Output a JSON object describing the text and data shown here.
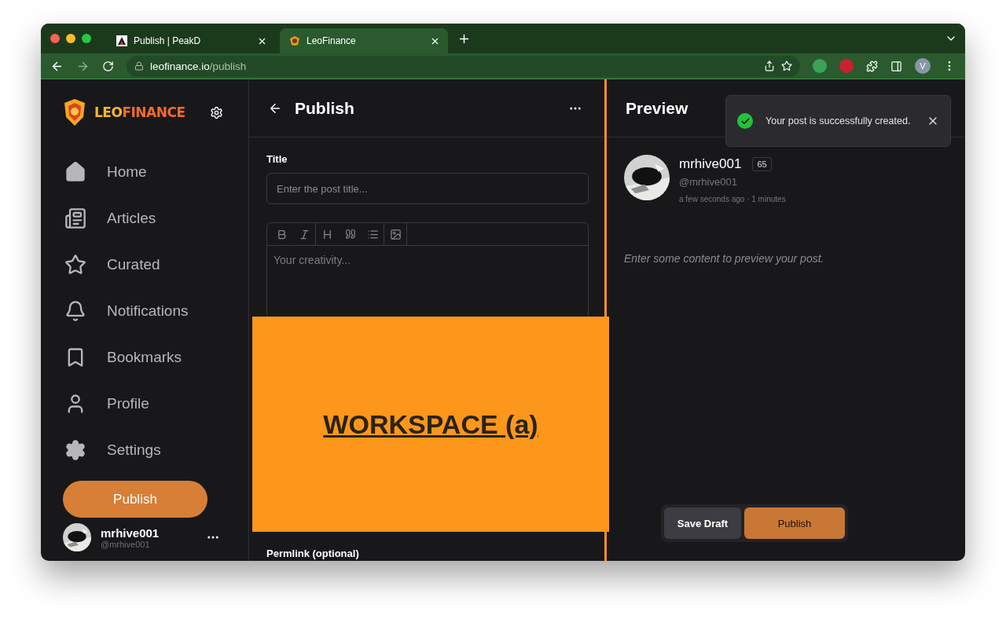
{
  "browser": {
    "tabs": [
      {
        "title": "Publish | PeakD",
        "selected": false
      },
      {
        "title": "LeoFinance",
        "selected": true
      }
    ],
    "address": {
      "host": "leofinance.io",
      "path": "/publish"
    },
    "profile_initial": "V"
  },
  "sidebar": {
    "logo": {
      "part_1": "LEO",
      "part_2": "FINANCE"
    },
    "items": [
      {
        "label": "Home",
        "kind": "home",
        "selected": false
      },
      {
        "label": "Articles",
        "kind": "articles",
        "selected": false
      },
      {
        "label": "Curated",
        "kind": "curated",
        "selected": false
      },
      {
        "label": "Notifications",
        "kind": "notifications",
        "selected": false
      },
      {
        "label": "Bookmarks",
        "kind": "bookmarks",
        "selected": false
      },
      {
        "label": "Profile",
        "kind": "profile",
        "selected": false
      },
      {
        "label": "Settings",
        "kind": "settings",
        "selected": false
      }
    ],
    "publish_button": "Publish",
    "user": {
      "name": "mrhive001",
      "handle": "@mrhive001"
    }
  },
  "editor": {
    "title": "Publish",
    "title_label": "Title",
    "title_placeholder": "Enter the post title...",
    "body_placeholder": "Your creativity...",
    "permlink_label": "Permlink (optional)"
  },
  "preview": {
    "title": "Preview",
    "author": {
      "name": "mrhive001",
      "reputation": "65",
      "handle": "@mrhive001",
      "time": "a few seconds ago · 1 minutes"
    },
    "empty_text": "Enter some content to preview your post.",
    "buttons": [
      {
        "label": "Save Draft",
        "kind": "secondary"
      },
      {
        "label": "Publish",
        "kind": "primary"
      }
    ]
  },
  "toast": {
    "message": "Your post is successfully created."
  },
  "overlay": {
    "label": "WORKSPACE (a)"
  }
}
